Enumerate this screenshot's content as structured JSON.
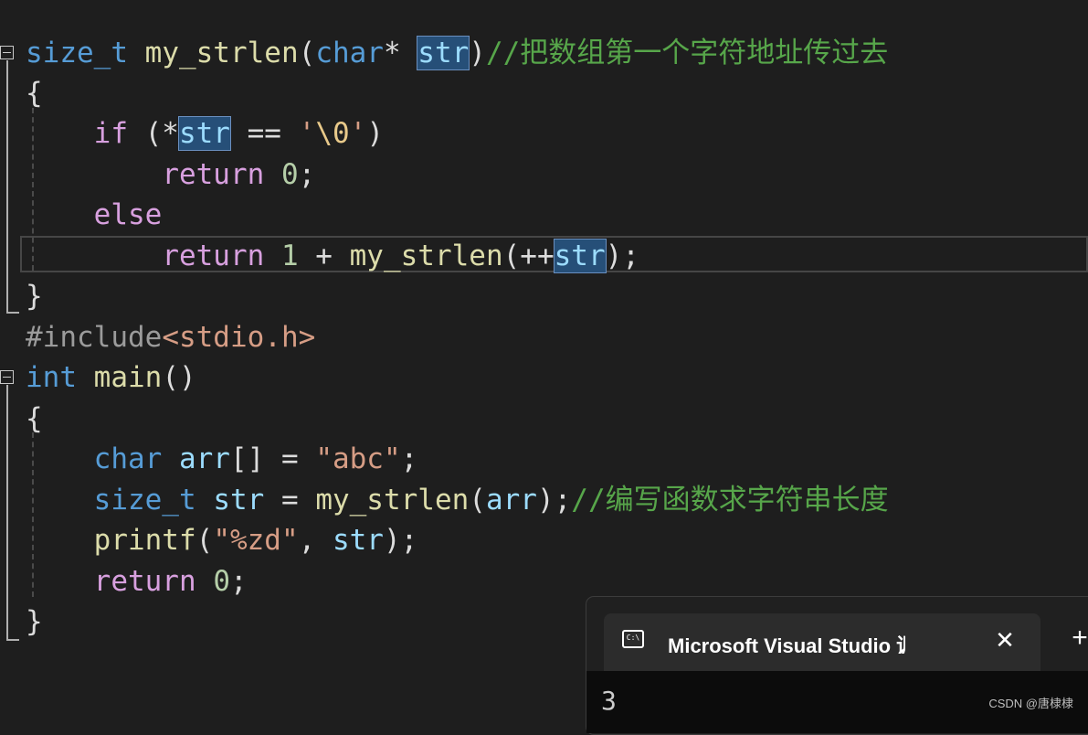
{
  "editor": {
    "lines": [
      [
        [
          "kw",
          "size_t"
        ],
        [
          "plain",
          " "
        ],
        [
          "fn",
          "my_strlen"
        ],
        [
          "plain",
          "("
        ],
        [
          "kw",
          "char"
        ],
        [
          "plain",
          "* "
        ],
        [
          "hl",
          "str"
        ],
        [
          "plain",
          ")"
        ],
        [
          "cmt",
          "//把数组第一个字符地址传过去"
        ]
      ],
      [
        [
          "plain",
          "{"
        ]
      ],
      [
        [
          "plain",
          "    "
        ],
        [
          "ctl",
          "if"
        ],
        [
          "plain",
          " (*"
        ],
        [
          "hl",
          "str"
        ],
        [
          "plain",
          " == "
        ],
        [
          "str",
          "'"
        ],
        [
          "esc",
          "\\0"
        ],
        [
          "str",
          "'"
        ],
        [
          "plain",
          ")"
        ]
      ],
      [
        [
          "plain",
          "        "
        ],
        [
          "ctl",
          "return"
        ],
        [
          "plain",
          " "
        ],
        [
          "num",
          "0"
        ],
        [
          "plain",
          ";"
        ]
      ],
      [
        [
          "plain",
          "    "
        ],
        [
          "ctl",
          "else"
        ]
      ],
      [
        [
          "plain",
          "        "
        ],
        [
          "ctl",
          "return"
        ],
        [
          "plain",
          " "
        ],
        [
          "num",
          "1"
        ],
        [
          "plain",
          " + "
        ],
        [
          "fn",
          "my_strlen"
        ],
        [
          "plain",
          "(++"
        ],
        [
          "hl",
          "str"
        ],
        [
          "plain",
          ");"
        ]
      ],
      [
        [
          "plain",
          "}"
        ]
      ],
      [
        [
          "pre",
          "#include"
        ],
        [
          "hdr",
          "<stdio.h>"
        ]
      ],
      [
        [
          "kw",
          "int"
        ],
        [
          "plain",
          " "
        ],
        [
          "fn",
          "main"
        ],
        [
          "plain",
          "()"
        ]
      ],
      [
        [
          "plain",
          "{"
        ]
      ],
      [
        [
          "plain",
          "    "
        ],
        [
          "kw",
          "char"
        ],
        [
          "plain",
          " "
        ],
        [
          "var",
          "arr"
        ],
        [
          "plain",
          "[] = "
        ],
        [
          "str",
          "\"abc\""
        ],
        [
          "plain",
          ";"
        ]
      ],
      [
        [
          "plain",
          "    "
        ],
        [
          "kw",
          "size_t"
        ],
        [
          "plain",
          " "
        ],
        [
          "var",
          "str"
        ],
        [
          "plain",
          " = "
        ],
        [
          "fn",
          "my_strlen"
        ],
        [
          "plain",
          "("
        ],
        [
          "var",
          "arr"
        ],
        [
          "plain",
          ");"
        ],
        [
          "cmt",
          "//编写函数求字符串长度"
        ]
      ],
      [
        [
          "plain",
          "    "
        ],
        [
          "fn",
          "printf"
        ],
        [
          "plain",
          "("
        ],
        [
          "str",
          "\"%zd\""
        ],
        [
          "plain",
          ", "
        ],
        [
          "var",
          "str"
        ],
        [
          "plain",
          ");"
        ]
      ],
      [
        [
          "plain",
          "    "
        ],
        [
          "ctl",
          "return"
        ],
        [
          "plain",
          " "
        ],
        [
          "num",
          "0"
        ],
        [
          "plain",
          ";"
        ]
      ],
      [
        [
          "plain",
          "}"
        ]
      ]
    ]
  },
  "console": {
    "icon_text": "C:\\",
    "title": "Microsoft Visual Studio 调试控制台",
    "close_glyph": "✕",
    "new_tab_glyph": "+",
    "output": "3"
  },
  "watermark": "CSDN @唐棣棣"
}
